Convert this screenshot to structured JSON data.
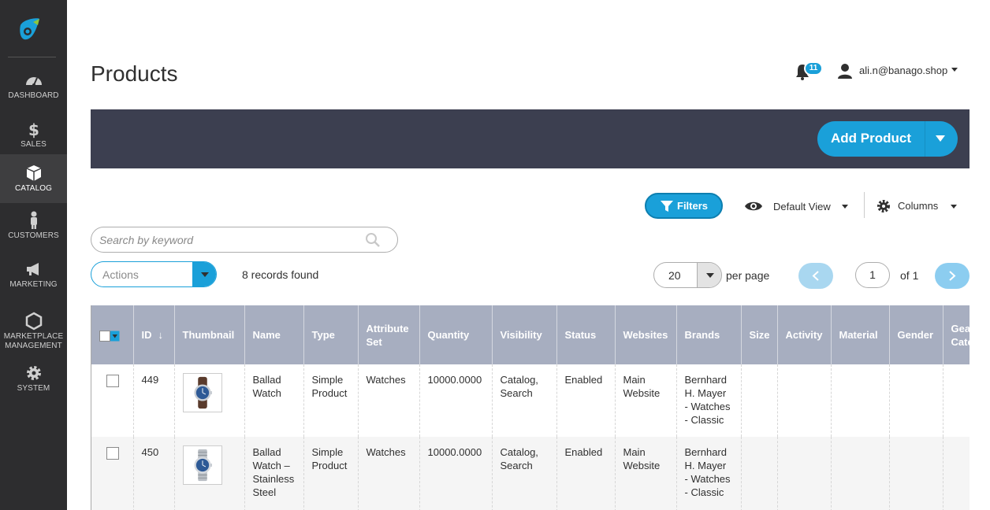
{
  "sidebar": {
    "items": [
      {
        "label": "DASHBOARD",
        "icon": "dashboard-icon"
      },
      {
        "label": "SALES",
        "icon": "dollar-icon"
      },
      {
        "label": "CATALOG",
        "icon": "box-icon"
      },
      {
        "label": "CUSTOMERS",
        "icon": "person-icon"
      },
      {
        "label": "MARKETPLACE MANAGEMENT",
        "icon": "hexagon-icon"
      },
      {
        "label": "SYSTEM",
        "icon": "gear-icon"
      }
    ],
    "marketing_label": "MARKETING",
    "marketplace_line1": "MARKETPLACE",
    "marketplace_line2": "MANAGEMENT"
  },
  "header": {
    "title": "Products",
    "notification_count": "11",
    "user_email": "ali.n@banago.shop"
  },
  "toolbar": {
    "add_product_label": "Add Product"
  },
  "controls": {
    "filters_label": "Filters",
    "view_label": "Default View",
    "columns_label": "Columns",
    "search_placeholder": "Search by keyword",
    "actions_label": "Actions",
    "records_found": "8 records found",
    "per_page_value": "20",
    "per_page_label": "per page",
    "page_current": "1",
    "page_of": "of 1"
  },
  "grid": {
    "columns": [
      "ID",
      "Thumbnail",
      "Name",
      "Type",
      "Attribute Set",
      "Quantity",
      "Visibility",
      "Status",
      "Websites",
      "Brands",
      "Size",
      "Activity",
      "Material",
      "Gender",
      "Gear Category"
    ],
    "column_labels": {
      "id": "ID",
      "thumbnail": "Thumbnail",
      "name": "Name",
      "type": "Type",
      "attr1": "Attribute",
      "attr2": "Set",
      "quantity": "Quantity",
      "visibility": "Visibility",
      "status": "Status",
      "websites": "Websites",
      "brands": "Brands",
      "size": "Size",
      "activity": "Activity",
      "material": "Material",
      "gender": "Gender",
      "gear1": "Gear",
      "gear2": "Category"
    },
    "rows": [
      {
        "id": "449",
        "name": [
          "Ballad",
          "Watch"
        ],
        "type": [
          "Simple",
          "Product"
        ],
        "attribute_set": "Watches",
        "quantity": "10000.0000",
        "visibility": [
          "Catalog,",
          "Search"
        ],
        "status": "Enabled",
        "websites": [
          "Main",
          "Website"
        ],
        "brands": [
          "Bernhard",
          "H. Mayer",
          "- Watches",
          "- Classic"
        ],
        "strap": "leather"
      },
      {
        "id": "450",
        "name": [
          "Ballad",
          "Watch –",
          "Stainless",
          "Steel"
        ],
        "type": [
          "Simple",
          "Product"
        ],
        "attribute_set": "Watches",
        "quantity": "10000.0000",
        "visibility": [
          "Catalog,",
          "Search"
        ],
        "status": "Enabled",
        "websites": [
          "Main",
          "Website"
        ],
        "brands": [
          "Bernhard",
          "H. Mayer",
          "- Watches",
          "- Classic"
        ],
        "strap": "steel"
      }
    ]
  },
  "colors": {
    "accent": "#1aa0d9",
    "sidebar": "#2d2d2f",
    "toolbar": "#3c3f50",
    "grid_header": "#a7aec0"
  }
}
